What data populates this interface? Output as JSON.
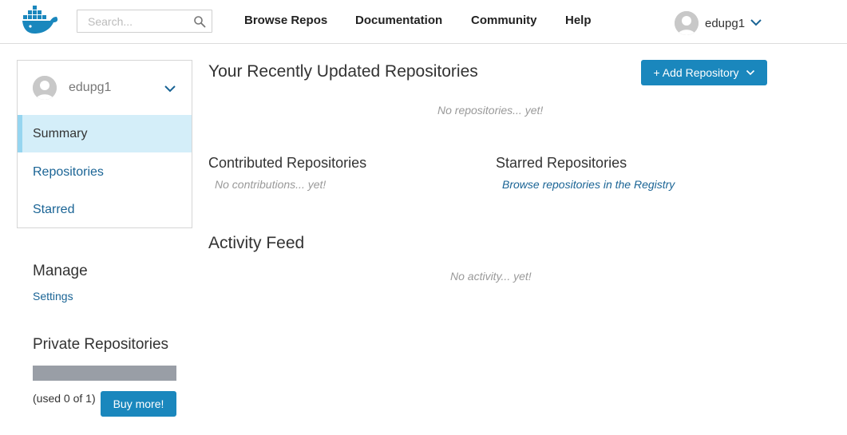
{
  "header": {
    "logo_icon": "docker-whale-icon",
    "search": {
      "placeholder": "Search...",
      "value": ""
    },
    "nav": [
      {
        "label": "Browse Repos"
      },
      {
        "label": "Documentation"
      },
      {
        "label": "Community"
      },
      {
        "label": "Help"
      }
    ],
    "user": {
      "name": "edupg1"
    }
  },
  "sidebar": {
    "user": {
      "name": "edupg1"
    },
    "items": [
      {
        "label": "Summary",
        "active": true
      },
      {
        "label": "Repositories",
        "active": false
      },
      {
        "label": "Starred",
        "active": false
      }
    ],
    "manage": {
      "title": "Manage",
      "settings_label": "Settings"
    },
    "private_repos": {
      "title": "Private Repositories",
      "used_fraction": 0,
      "used_text": "(used 0 of 1)",
      "buy_label": "Buy more!"
    }
  },
  "main": {
    "recent": {
      "title": "Your Recently Updated Repositories",
      "add_label": "+ Add Repository",
      "empty_text": "No repositories... yet!"
    },
    "contributed": {
      "title": "Contributed Repositories",
      "empty_text": "No contributions... yet!"
    },
    "starred": {
      "title": "Starred Repositories",
      "link_text": "Browse repositories in the Registry"
    },
    "activity": {
      "title": "Activity Feed",
      "empty_text": "No activity... yet!"
    }
  },
  "colors": {
    "accent": "#1a87bd",
    "link": "#1a6495",
    "active_bg": "#d4eef9",
    "active_bar": "#96d5f0",
    "progress_bg": "#999ea6"
  }
}
